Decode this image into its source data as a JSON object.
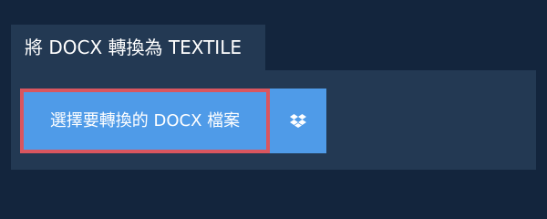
{
  "tab": {
    "label": "將 DOCX 轉換為 TEXTILE"
  },
  "upload": {
    "choose_file_label": "選擇要轉換的 DOCX 檔案",
    "dropbox_icon": "dropbox-icon"
  },
  "colors": {
    "page_background": "#13253d",
    "panel_background": "#233953",
    "button_background": "#4f9be8",
    "button_focus_border": "#d9565f",
    "text": "#ffffff"
  }
}
